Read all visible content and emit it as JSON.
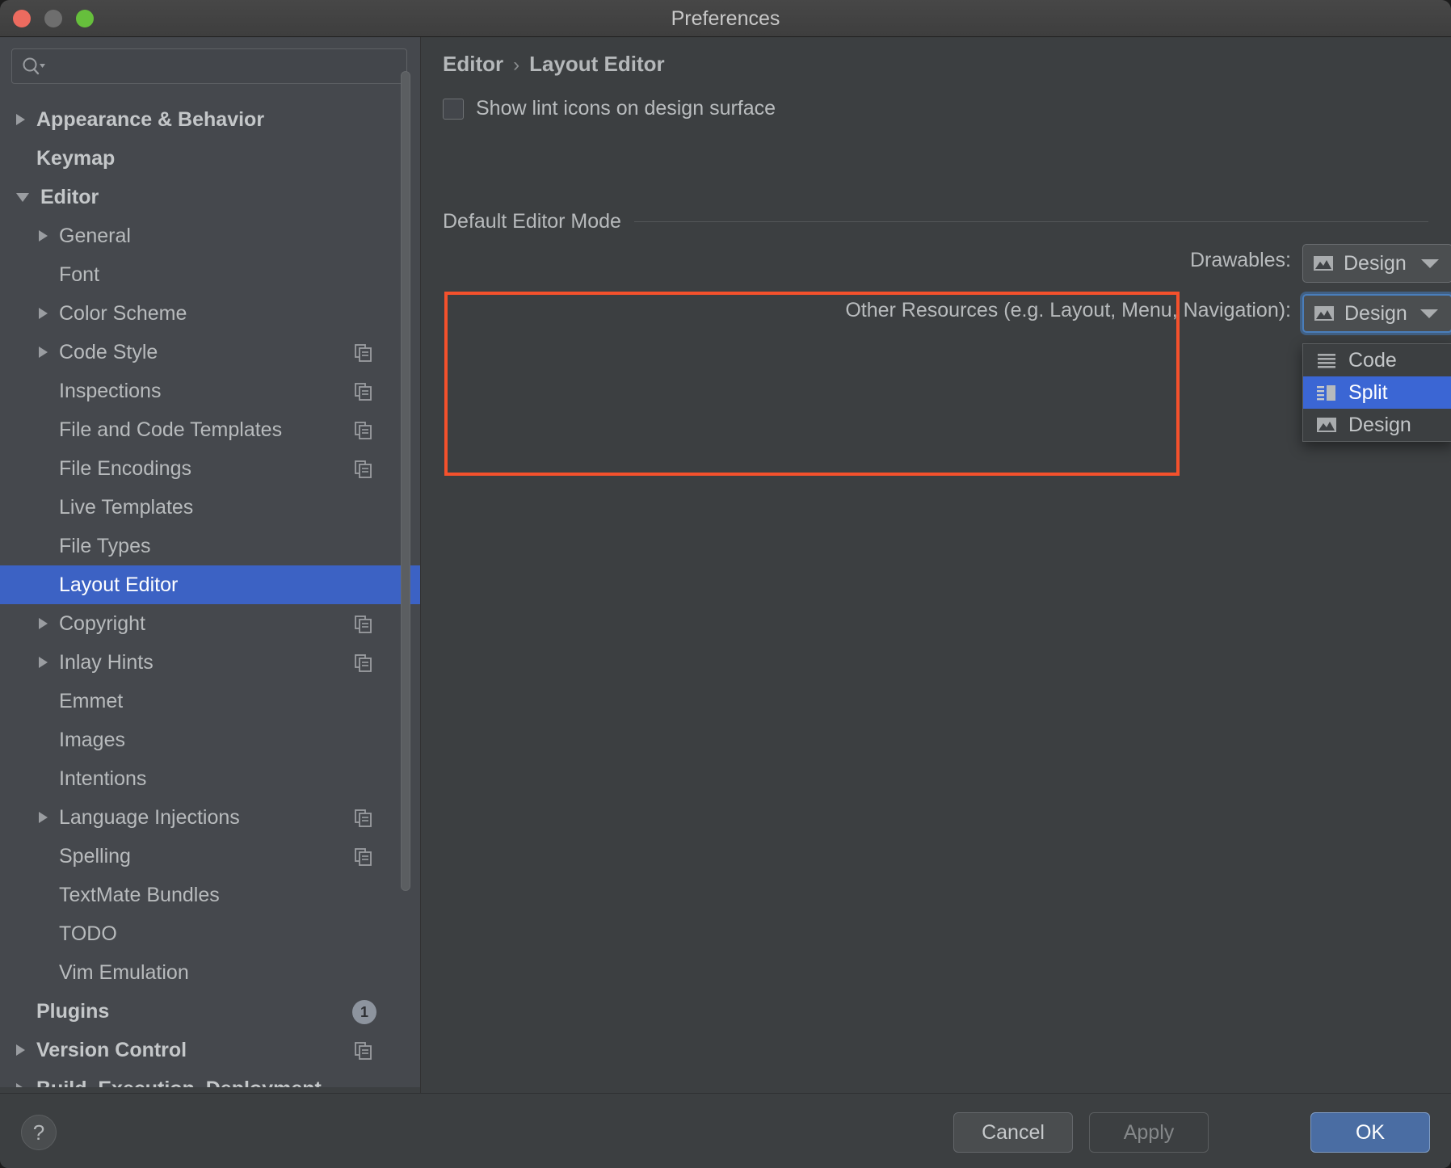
{
  "window": {
    "title": "Preferences",
    "traffic_lights": [
      "close",
      "minimize",
      "maximize"
    ]
  },
  "sidebar": {
    "search": {
      "value": "",
      "placeholder": ""
    },
    "items": [
      {
        "label": "Appearance & Behavior",
        "indent": 0,
        "twisty": "collapsed",
        "bold": true,
        "copy": false,
        "badge": null,
        "selected": false
      },
      {
        "label": "Keymap",
        "indent": 0,
        "twisty": "none",
        "bold": true,
        "copy": false,
        "badge": null,
        "selected": false
      },
      {
        "label": "Editor",
        "indent": 0,
        "twisty": "expanded",
        "bold": true,
        "copy": false,
        "badge": null,
        "selected": false
      },
      {
        "label": "General",
        "indent": 1,
        "twisty": "collapsed",
        "bold": false,
        "copy": false,
        "badge": null,
        "selected": false
      },
      {
        "label": "Font",
        "indent": 1,
        "twisty": "none",
        "bold": false,
        "copy": false,
        "badge": null,
        "selected": false
      },
      {
        "label": "Color Scheme",
        "indent": 1,
        "twisty": "collapsed",
        "bold": false,
        "copy": false,
        "badge": null,
        "selected": false
      },
      {
        "label": "Code Style",
        "indent": 1,
        "twisty": "collapsed",
        "bold": false,
        "copy": true,
        "badge": null,
        "selected": false
      },
      {
        "label": "Inspections",
        "indent": 1,
        "twisty": "none",
        "bold": false,
        "copy": true,
        "badge": null,
        "selected": false
      },
      {
        "label": "File and Code Templates",
        "indent": 1,
        "twisty": "none",
        "bold": false,
        "copy": true,
        "badge": null,
        "selected": false
      },
      {
        "label": "File Encodings",
        "indent": 1,
        "twisty": "none",
        "bold": false,
        "copy": true,
        "badge": null,
        "selected": false
      },
      {
        "label": "Live Templates",
        "indent": 1,
        "twisty": "none",
        "bold": false,
        "copy": false,
        "badge": null,
        "selected": false
      },
      {
        "label": "File Types",
        "indent": 1,
        "twisty": "none",
        "bold": false,
        "copy": false,
        "badge": null,
        "selected": false
      },
      {
        "label": "Layout Editor",
        "indent": 1,
        "twisty": "none",
        "bold": false,
        "copy": false,
        "badge": null,
        "selected": true
      },
      {
        "label": "Copyright",
        "indent": 1,
        "twisty": "collapsed",
        "bold": false,
        "copy": true,
        "badge": null,
        "selected": false
      },
      {
        "label": "Inlay Hints",
        "indent": 1,
        "twisty": "collapsed",
        "bold": false,
        "copy": true,
        "badge": null,
        "selected": false
      },
      {
        "label": "Emmet",
        "indent": 1,
        "twisty": "none",
        "bold": false,
        "copy": false,
        "badge": null,
        "selected": false
      },
      {
        "label": "Images",
        "indent": 1,
        "twisty": "none",
        "bold": false,
        "copy": false,
        "badge": null,
        "selected": false
      },
      {
        "label": "Intentions",
        "indent": 1,
        "twisty": "none",
        "bold": false,
        "copy": false,
        "badge": null,
        "selected": false
      },
      {
        "label": "Language Injections",
        "indent": 1,
        "twisty": "collapsed",
        "bold": false,
        "copy": true,
        "badge": null,
        "selected": false
      },
      {
        "label": "Spelling",
        "indent": 1,
        "twisty": "none",
        "bold": false,
        "copy": true,
        "badge": null,
        "selected": false
      },
      {
        "label": "TextMate Bundles",
        "indent": 1,
        "twisty": "none",
        "bold": false,
        "copy": false,
        "badge": null,
        "selected": false
      },
      {
        "label": "TODO",
        "indent": 1,
        "twisty": "none",
        "bold": false,
        "copy": false,
        "badge": null,
        "selected": false
      },
      {
        "label": "Vim Emulation",
        "indent": 1,
        "twisty": "none",
        "bold": false,
        "copy": false,
        "badge": null,
        "selected": false
      },
      {
        "label": "Plugins",
        "indent": 0,
        "twisty": "none",
        "bold": true,
        "copy": false,
        "badge": "1",
        "selected": false
      },
      {
        "label": "Version Control",
        "indent": 0,
        "twisty": "collapsed",
        "bold": true,
        "copy": true,
        "badge": null,
        "selected": false
      },
      {
        "label": "Build, Execution, Deployment",
        "indent": 0,
        "twisty": "collapsed",
        "bold": true,
        "copy": false,
        "badge": null,
        "selected": false
      }
    ]
  },
  "main": {
    "breadcrumb": {
      "parent": "Editor",
      "separator": "›",
      "current": "Layout Editor"
    },
    "lint_checkbox": {
      "label": "Show lint icons on design surface",
      "checked": false
    },
    "section": {
      "title": "Default Editor Mode"
    },
    "rows": [
      {
        "label": "Drawables:",
        "value": "Design",
        "icon": "image-icon",
        "focused": false
      },
      {
        "label": "Other Resources (e.g. Layout, Menu, Navigation):",
        "value": "Design",
        "icon": "image-icon",
        "focused": true
      }
    ],
    "dropdown": {
      "open": true,
      "options": [
        {
          "label": "Code",
          "icon": "code-lines-icon",
          "selected": false
        },
        {
          "label": "Split",
          "icon": "split-view-icon",
          "selected": true
        },
        {
          "label": "Design",
          "icon": "image-icon",
          "selected": false
        }
      ]
    },
    "highlight_color": "#f4512c"
  },
  "footer": {
    "help_label": "?",
    "cancel_label": "Cancel",
    "apply_label": "Apply",
    "ok_label": "OK"
  },
  "colors": {
    "accent_blue": "#3c62c4",
    "selection_blue": "#3b66d4",
    "ok_blue": "#4a6da3",
    "highlight_red": "#f4512c",
    "sidebar_bg": "#45484d",
    "main_bg": "#3c3f41"
  }
}
